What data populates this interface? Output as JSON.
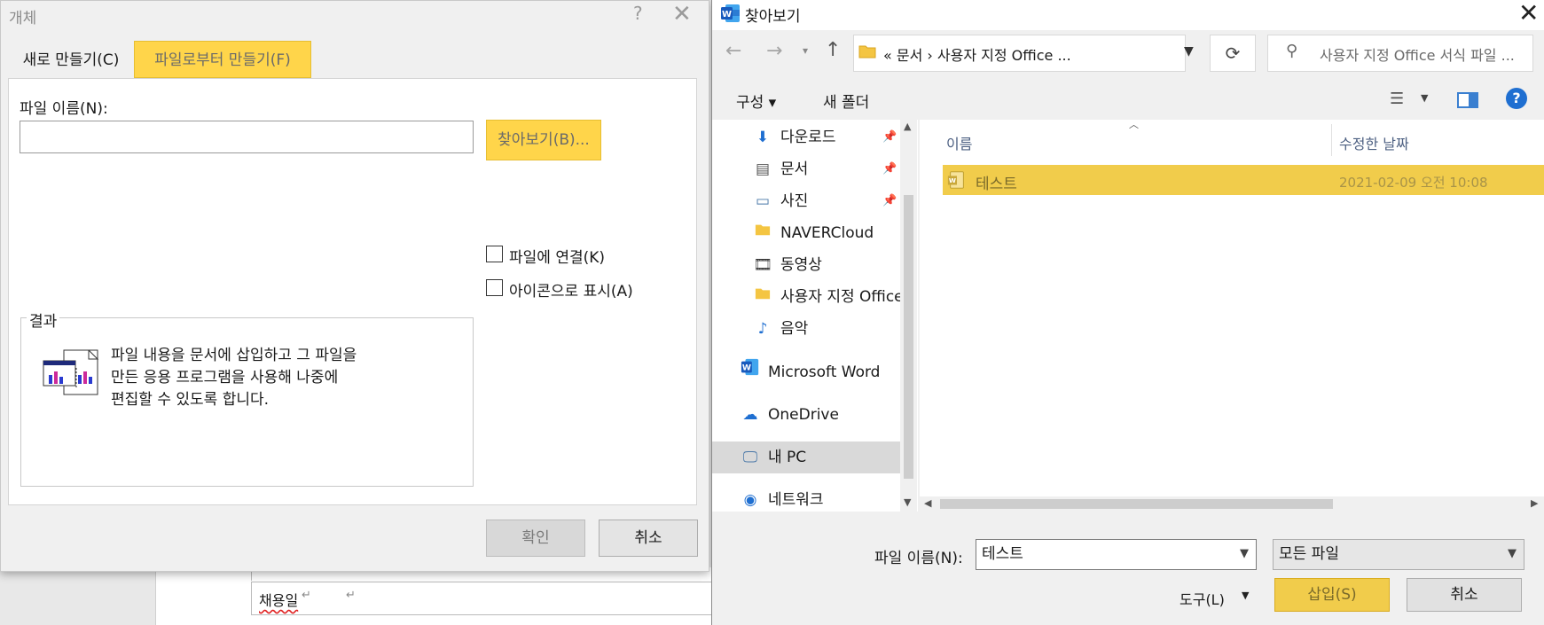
{
  "document": {
    "cell_text": "채용일",
    "paragraph_mark": "↵"
  },
  "object_dialog": {
    "title": "개체",
    "help": "?",
    "close": "✕",
    "tabs": [
      {
        "label": "새로 만들기(C)"
      },
      {
        "label": "파일로부터 만들기(F)"
      }
    ],
    "filename_label": "파일 이름(N):",
    "filename_value": "",
    "browse_label": "찾아보기(B)...",
    "link_label": "파일에 연결(K)",
    "display_icon_label": "아이콘으로 표시(A)",
    "result_label": "결과",
    "result_lines": [
      "파일 내용을 문서에 삽입하고 그 파일을",
      "만든 응용 프로그램을 사용해 나중에",
      "편집할 수 있도록 합니다."
    ],
    "ok_label": "확인",
    "cancel_label": "취소",
    "highlight_color": "#ffd54a"
  },
  "browse_dialog": {
    "title": "찾아보기",
    "address": "«  문서  ›  사용자 지정 Office ...",
    "search_placeholder": "사용자 지정 Office 서식 파일 ...",
    "toolbar": {
      "organize": "구성 ▾",
      "new_folder": "새 폴더"
    },
    "nav_items": [
      {
        "label": "다운로드",
        "icon": "download-icon",
        "pinned": true
      },
      {
        "label": "문서",
        "icon": "documents-icon",
        "pinned": true
      },
      {
        "label": "사진",
        "icon": "pictures-icon",
        "pinned": true
      },
      {
        "label": "NAVERCloud",
        "icon": "folder-icon",
        "pinned": false
      },
      {
        "label": "동영상",
        "icon": "videos-icon",
        "pinned": false
      },
      {
        "label": "사용자 지정 Office",
        "icon": "folder-icon",
        "pinned": false
      },
      {
        "label": "음악",
        "icon": "music-icon",
        "pinned": false
      },
      {
        "label": "Microsoft Word",
        "icon": "word-icon",
        "pinned": false
      },
      {
        "label": "OneDrive",
        "icon": "onedrive-icon",
        "pinned": false
      },
      {
        "label": "내 PC",
        "icon": "pc-icon",
        "pinned": false,
        "selected": true
      },
      {
        "label": "네트워크",
        "icon": "network-icon",
        "pinned": false
      }
    ],
    "columns": {
      "name": "이름",
      "date": "수정한 날짜"
    },
    "files": [
      {
        "name": "테스트",
        "date": "2021-02-09 오전 10:08",
        "selected": true
      }
    ],
    "filename_label": "파일 이름(N):",
    "filename_value": "테스트",
    "filetype_value": "모든 파일",
    "tools_label": "도구(L)",
    "insert_label": "삽입(S)",
    "cancel_label": "취소",
    "highlight_color": "#f1cc4b"
  }
}
